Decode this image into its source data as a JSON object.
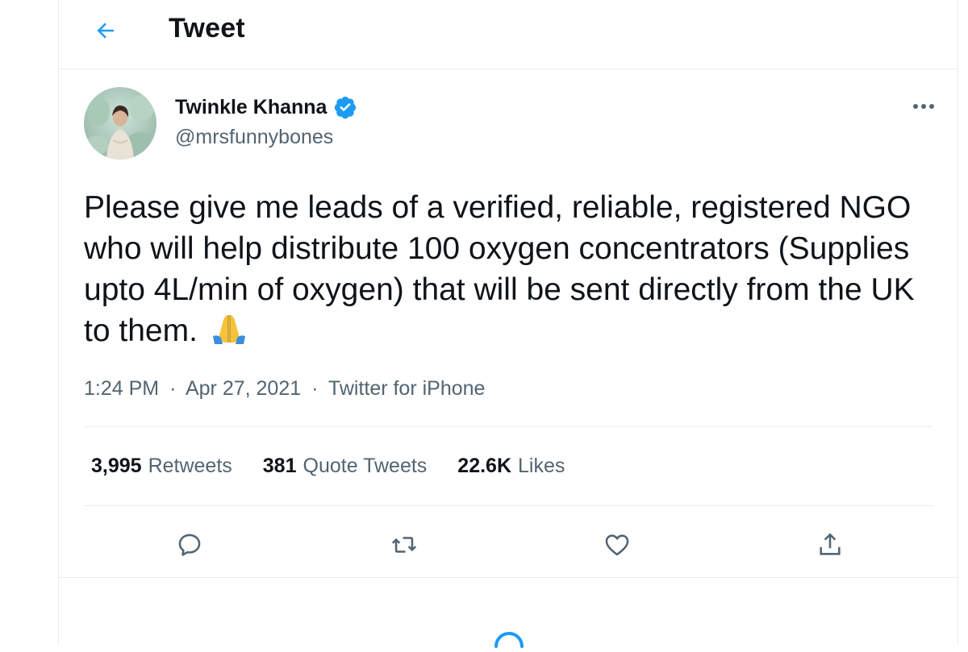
{
  "header": {
    "back_icon": "arrow-left-icon",
    "title": "Tweet"
  },
  "tweet": {
    "author": {
      "name": "Twinkle Khanna",
      "handle": "@mrsfunnybones",
      "verified_icon": "verified-badge-icon",
      "avatar_icon": "profile-photo"
    },
    "more_icon": "more-options-icon",
    "text": "Please give me leads of a verified, reliable, registered NGO who will help distribute 100 oxygen concentrators (Supplies upto 4L/min of oxygen) that will be sent directly from the UK to them.",
    "emoji": "🙏",
    "meta": {
      "time": "1:24 PM",
      "date": "Apr 27, 2021",
      "source": "Twitter for iPhone",
      "separator": "·"
    },
    "stats": [
      {
        "count": "3,995",
        "label": "Retweets"
      },
      {
        "count": "381",
        "label": "Quote Tweets"
      },
      {
        "count": "22.6K",
        "label": "Likes"
      }
    ],
    "actions": [
      "reply-icon",
      "retweet-icon",
      "like-icon",
      "share-icon"
    ]
  },
  "colors": {
    "accent": "#1d9bf0",
    "text": "#0f1419",
    "muted": "#536471",
    "border": "#e6ecf0"
  }
}
